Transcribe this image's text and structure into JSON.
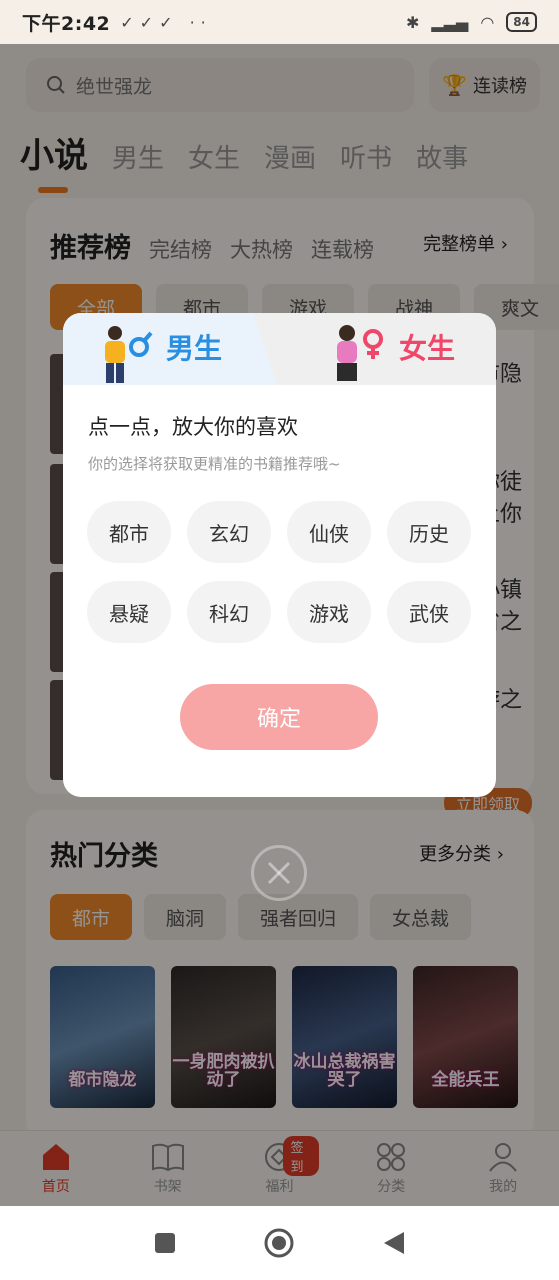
{
  "status_bar": {
    "time": "下午2:42",
    "battery": "84"
  },
  "search": {
    "placeholder": "绝世强龙"
  },
  "header": {
    "rank_button": "连读榜"
  },
  "top_tabs": [
    "小说",
    "男生",
    "女生",
    "漫画",
    "听书",
    "故事"
  ],
  "recommend": {
    "title": "推荐榜",
    "tabs": [
      "完结榜",
      "大热榜",
      "连载榜"
    ],
    "more": "完整榜单",
    "chips": [
      "全部",
      "都市",
      "游戏",
      "战神",
      "爽文"
    ],
    "peek_text": [
      "市隐",
      "你徒",
      "上你",
      "小镇",
      "省之",
      "游之"
    ],
    "ad_button": "立即领取"
  },
  "hot": {
    "title": "热门分类",
    "more": "更多分类",
    "chips": [
      "都市",
      "脑洞",
      "强者回归",
      "女总裁"
    ],
    "books": [
      "都市隐龙",
      "一身肥肉被扒动了",
      "冰山总裁祸害哭了",
      "全能兵王"
    ]
  },
  "bottom_nav": {
    "items": [
      "首页",
      "书架",
      "福利",
      "分类",
      "我的"
    ],
    "badge": "签到"
  },
  "dialog": {
    "male": "男生",
    "female": "女生",
    "title": "点一点，放大你的喜欢",
    "subtitle": "你的选择将获取更精准的书籍推荐哦~",
    "categories": [
      "都市",
      "玄幻",
      "仙侠",
      "历史",
      "悬疑",
      "科幻",
      "游戏",
      "武侠"
    ],
    "confirm": "确定"
  }
}
